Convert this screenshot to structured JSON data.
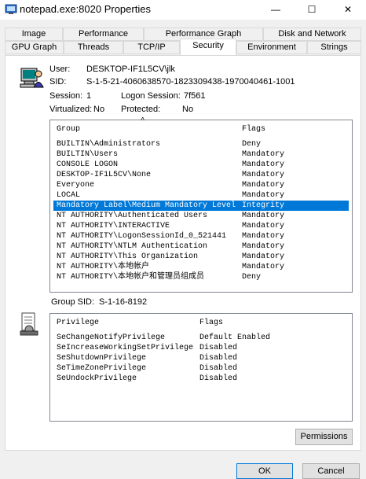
{
  "window": {
    "title": "notepad.exe:8020 Properties",
    "minimize": "—",
    "maximize": "☐",
    "close": "✕"
  },
  "tabs": {
    "row1": [
      "Image",
      "Performance",
      "Performance Graph",
      "Disk and Network"
    ],
    "row2": [
      "GPU Graph",
      "Threads",
      "TCP/IP",
      "Security",
      "Environment",
      "Strings"
    ],
    "active": "Security"
  },
  "identity": {
    "user_label": "User:",
    "user_value": "DESKTOP-IF1L5CV\\jlk",
    "sid_label": "SID:",
    "sid_value": "S-1-5-21-4060638570-1823309438-1970040461-1001",
    "session_label": "Session:",
    "session_value": "1",
    "logon_label": "Logon Session:",
    "logon_value": "7f561",
    "virtualized_label": "Virtualized:",
    "virtualized_value": "No",
    "protected_label": "Protected:",
    "protected_value": "No"
  },
  "groups": {
    "col_group": "Group",
    "col_flags": "Flags",
    "rows": [
      {
        "group": "BUILTIN\\Administrators",
        "flags": "Deny"
      },
      {
        "group": "BUILTIN\\Users",
        "flags": "Mandatory"
      },
      {
        "group": "CONSOLE LOGON",
        "flags": "Mandatory"
      },
      {
        "group": "DESKTOP-IF1L5CV\\None",
        "flags": "Mandatory"
      },
      {
        "group": "Everyone",
        "flags": "Mandatory"
      },
      {
        "group": "LOCAL",
        "flags": "Mandatory"
      },
      {
        "group": "Mandatory Label\\Medium Mandatory Level",
        "flags": "Integrity"
      },
      {
        "group": "NT AUTHORITY\\Authenticated Users",
        "flags": "Mandatory"
      },
      {
        "group": "NT AUTHORITY\\INTERACTIVE",
        "flags": "Mandatory"
      },
      {
        "group": "NT AUTHORITY\\LogonSessionId_0_521441",
        "flags": "Mandatory"
      },
      {
        "group": "NT AUTHORITY\\NTLM Authentication",
        "flags": "Mandatory"
      },
      {
        "group": "NT AUTHORITY\\This Organization",
        "flags": "Mandatory"
      },
      {
        "group": "NT AUTHORITY\\本地帐户",
        "flags": "Mandatory"
      },
      {
        "group": "NT AUTHORITY\\本地帐户和管理员组成员",
        "flags": "Deny"
      }
    ],
    "selected_row": "Mandatory Label\\Medium Mandatory Level"
  },
  "group_sid": {
    "label": "Group SID:",
    "value": "S-1-16-8192"
  },
  "privileges": {
    "col_privilege": "Privilege",
    "col_flags": "Flags",
    "rows": [
      {
        "privilege": "SeChangeNotifyPrivilege",
        "flags": "Default Enabled"
      },
      {
        "privilege": "SeIncreaseWorkingSetPrivilege",
        "flags": "Disabled"
      },
      {
        "privilege": "SeShutdownPrivilege",
        "flags": "Disabled"
      },
      {
        "privilege": "SeTimeZonePrivilege",
        "flags": "Disabled"
      },
      {
        "privilege": "SeUndockPrivilege",
        "flags": "Disabled"
      }
    ]
  },
  "buttons": {
    "permissions": "Permissions",
    "ok": "OK",
    "cancel": "Cancel"
  },
  "colors": {
    "selection": "#0078d7",
    "accent_border": "#0078d7"
  }
}
